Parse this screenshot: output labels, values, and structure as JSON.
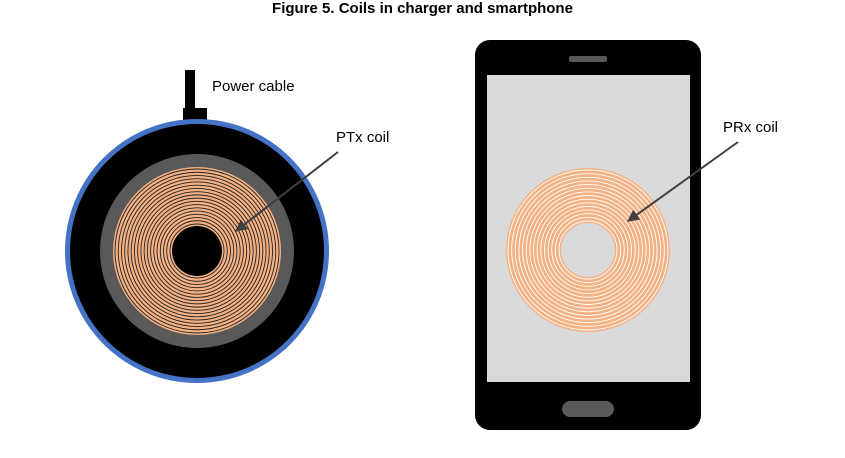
{
  "figure": {
    "title": "Figure 5. Coils in charger and smartphone"
  },
  "labels": {
    "power_cable": "Power cable",
    "ptx_coil": "PTx coil",
    "prx_coil": "PRx coil"
  },
  "colors": {
    "charger_rim": "#4472c4",
    "charger_body": "#000000",
    "coil_ring": "#595959",
    "coil_copper": "#f4b183",
    "coil_winding_charger": "#222222",
    "coil_winding_phone": "#ffffff",
    "phone_body": "#000000",
    "phone_screen": "#d9d9d9",
    "phone_button": "#595959"
  },
  "coils": {
    "ptx_turns": 17,
    "prx_turns": 14
  }
}
